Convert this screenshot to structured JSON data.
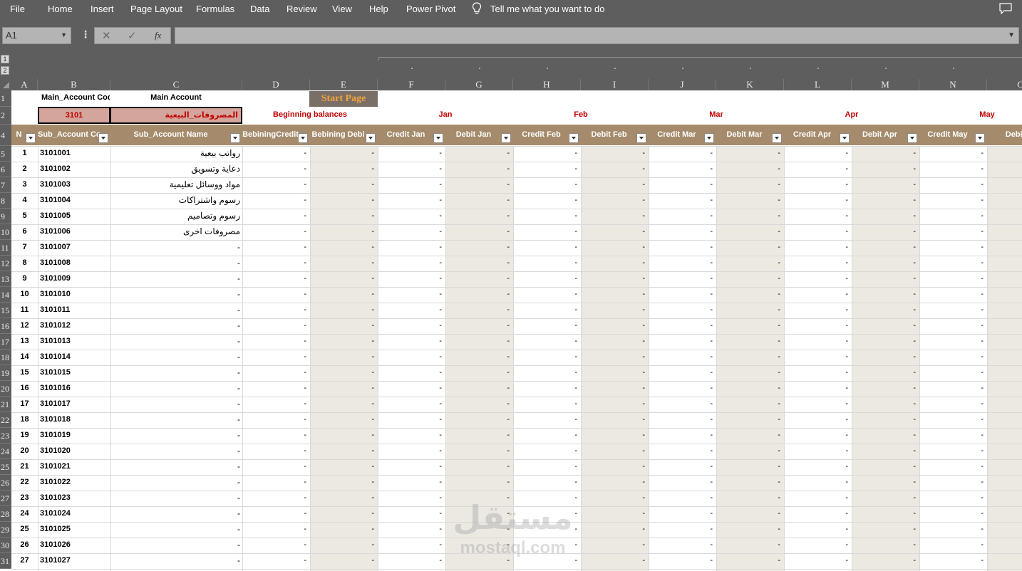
{
  "menu": [
    "File",
    "Home",
    "Insert",
    "Page Layout",
    "Formulas",
    "Data",
    "Review",
    "View",
    "Help",
    "Power Pivot"
  ],
  "tell_me": "Tell me what you want to do",
  "name_box": "A1",
  "formula_value": "",
  "fx_label": "fx",
  "outline_levels": [
    "1",
    "2"
  ],
  "columns": [
    "A",
    "B",
    "C",
    "D",
    "E",
    "F",
    "G",
    "H",
    "I",
    "J",
    "K",
    "L",
    "M",
    "N",
    "O"
  ],
  "row1": {
    "b": "Main_Account Code",
    "c": "Main Account",
    "start_button": "Start Page"
  },
  "row2": {
    "code": "3101",
    "name": "المصروفات_البيعية",
    "groups": [
      "Beginning balances",
      "Jan",
      "Feb",
      "Mar",
      "Apr",
      "May"
    ]
  },
  "table_headers": [
    "N",
    "Sub_Account Co",
    "Sub_Account Name",
    "BebiningCredit",
    "Bebining Debi",
    "Credit Jan",
    "Debit Jan",
    "Credit Feb",
    "Debit Feb",
    "Credit Mar",
    "Debit Mar",
    "Credit Apr",
    "Debit Apr",
    "Credit May",
    "Debit"
  ],
  "row_numbers": [
    "1",
    "2",
    "4",
    "5",
    "6",
    "7",
    "8",
    "9",
    "10",
    "11",
    "12",
    "13",
    "14",
    "15",
    "16",
    "17",
    "18",
    "19",
    "20",
    "21",
    "22",
    "23",
    "24",
    "25",
    "26",
    "27",
    "28",
    "29",
    "30",
    "31"
  ],
  "rows": [
    {
      "n": "1",
      "code": "3101001",
      "name": "رواتب بيعية"
    },
    {
      "n": "2",
      "code": "3101002",
      "name": "دعاية وتسويق"
    },
    {
      "n": "3",
      "code": "3101003",
      "name": "مواد ووسائل تعليمية"
    },
    {
      "n": "4",
      "code": "3101004",
      "name": "رسوم واشتراكات"
    },
    {
      "n": "5",
      "code": "3101005",
      "name": "رسوم وتصاميم"
    },
    {
      "n": "6",
      "code": "3101006",
      "name": "مصروفات اخرى"
    },
    {
      "n": "7",
      "code": "3101007",
      "name": "-"
    },
    {
      "n": "8",
      "code": "3101008",
      "name": "-"
    },
    {
      "n": "9",
      "code": "3101009",
      "name": "-"
    },
    {
      "n": "10",
      "code": "3101010",
      "name": "-"
    },
    {
      "n": "11",
      "code": "3101011",
      "name": "-"
    },
    {
      "n": "12",
      "code": "3101012",
      "name": "-"
    },
    {
      "n": "13",
      "code": "3101013",
      "name": "-"
    },
    {
      "n": "14",
      "code": "3101014",
      "name": "-"
    },
    {
      "n": "15",
      "code": "3101015",
      "name": "-"
    },
    {
      "n": "16",
      "code": "3101016",
      "name": "-"
    },
    {
      "n": "17",
      "code": "3101017",
      "name": "-"
    },
    {
      "n": "18",
      "code": "3101018",
      "name": "-"
    },
    {
      "n": "19",
      "code": "3101019",
      "name": "-"
    },
    {
      "n": "20",
      "code": "3101020",
      "name": "-"
    },
    {
      "n": "21",
      "code": "3101021",
      "name": "-"
    },
    {
      "n": "22",
      "code": "3101022",
      "name": "-"
    },
    {
      "n": "23",
      "code": "3101023",
      "name": "-"
    },
    {
      "n": "24",
      "code": "3101024",
      "name": "-"
    },
    {
      "n": "25",
      "code": "3101025",
      "name": "-"
    },
    {
      "n": "26",
      "code": "3101026",
      "name": "-"
    },
    {
      "n": "27",
      "code": "3101027",
      "name": "-"
    }
  ],
  "empty_value": "-",
  "watermark": {
    "arabic": "مستقل",
    "latin": "mostaql.com"
  },
  "colors": {
    "ribbon": "#5e5e5e",
    "table_header": "#a58b6b",
    "accent_red": "#c00000",
    "button_text": "#f0a33c",
    "shade": "#ece9e2"
  }
}
